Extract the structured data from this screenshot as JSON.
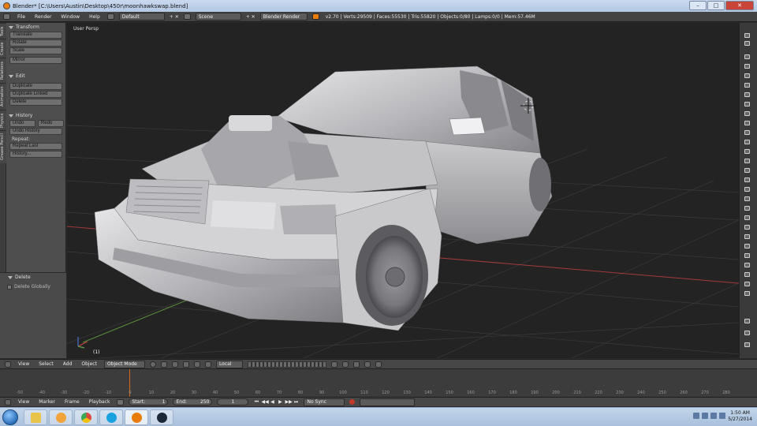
{
  "window": {
    "title": "Blender* [C:\\Users\\Austin\\Desktop\\450r\\moonhawkswap.blend]"
  },
  "infobar": {
    "menus": [
      "File",
      "Render",
      "Window",
      "Help"
    ],
    "layout": "Default",
    "scene": "Scene",
    "engine": "Blender Render",
    "stats": "v2.70 | Verts:29509 | Faces:55530 | Tris:55820 | Objects:0/80 | Lamps:0/0 | Mem:57.46M"
  },
  "toolshelf": {
    "tabs": [
      "Tools",
      "Create",
      "Relations",
      "Animation",
      "Physics",
      "Grease Pencil"
    ],
    "transform": {
      "header": "Transform",
      "buttons": [
        "Translate",
        "Rotate",
        "Scale",
        "Mirror"
      ]
    },
    "edit": {
      "header": "Edit",
      "buttons": [
        "Duplicate",
        "Duplicate Linked",
        "Delete"
      ]
    },
    "history": {
      "header": "History",
      "undo": "Undo",
      "redo": "Redo",
      "undo_history": "Undo History",
      "repeat_label": "Repeat:",
      "repeat_last": "Repeat Last",
      "history": "History..."
    },
    "operator": {
      "header": "Delete",
      "option": "Delete Globally"
    }
  },
  "viewport": {
    "label": "User Persp",
    "object_label": "(1)"
  },
  "viewport_header": {
    "menus": [
      "View",
      "Select",
      "Add",
      "Object"
    ],
    "mode": "Object Mode",
    "pivot": "Local"
  },
  "timeline": {
    "ruler": [
      "-50",
      "-40",
      "-30",
      "-20",
      "-10",
      "0",
      "10",
      "20",
      "30",
      "40",
      "50",
      "60",
      "70",
      "80",
      "90",
      "100",
      "110",
      "120",
      "130",
      "140",
      "150",
      "160",
      "170",
      "180",
      "190",
      "200",
      "210",
      "220",
      "230",
      "240",
      "250",
      "260",
      "270",
      "280"
    ],
    "current_frame": "0"
  },
  "timeline_header": {
    "menus": [
      "View",
      "Marker",
      "Frame",
      "Playback"
    ],
    "start_label": "Start:",
    "start_value": "1",
    "end_label": "End:",
    "end_value": "250",
    "frame_value": "1",
    "sync": "No Sync"
  },
  "taskbar": {
    "apps": [
      "explorer-icon",
      "media-player-icon",
      "chrome-icon",
      "skype-icon",
      "blender-icon",
      "steam-icon"
    ],
    "time": "1:50 AM",
    "date": "5/27/2014"
  },
  "colors": {
    "viewport_bg": "#232323",
    "x_axis": "#a33a3a",
    "y_axis": "#5a8f3a",
    "frame_marker": "#d46a1b"
  }
}
